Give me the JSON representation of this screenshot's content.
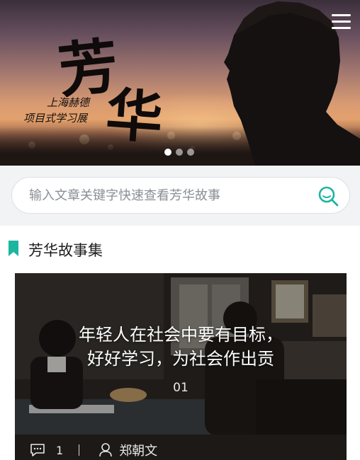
{
  "banner": {
    "title_char_1": "芳",
    "title_char_2": "华",
    "subtitle_line_1": "上海赫德",
    "subtitle_line_2": "项目式学习展",
    "carousel_total": 3,
    "carousel_active": 1
  },
  "search": {
    "placeholder": "输入文章关键字快速查看芳华故事"
  },
  "section": {
    "title": "芳华故事集"
  },
  "story": {
    "title_line_1": "年轻人在社会中要有目标，",
    "title_line_2": "好好学习，为社会作出贡",
    "index": "01",
    "comment_count": "1",
    "author": "郑朝文"
  },
  "colors": {
    "accent_teal": "#1bb5a0",
    "section_bg": "#f2f3f5"
  },
  "icons": [
    "menu-icon",
    "search-icon",
    "bookmark-icon",
    "comment-icon",
    "user-icon"
  ]
}
